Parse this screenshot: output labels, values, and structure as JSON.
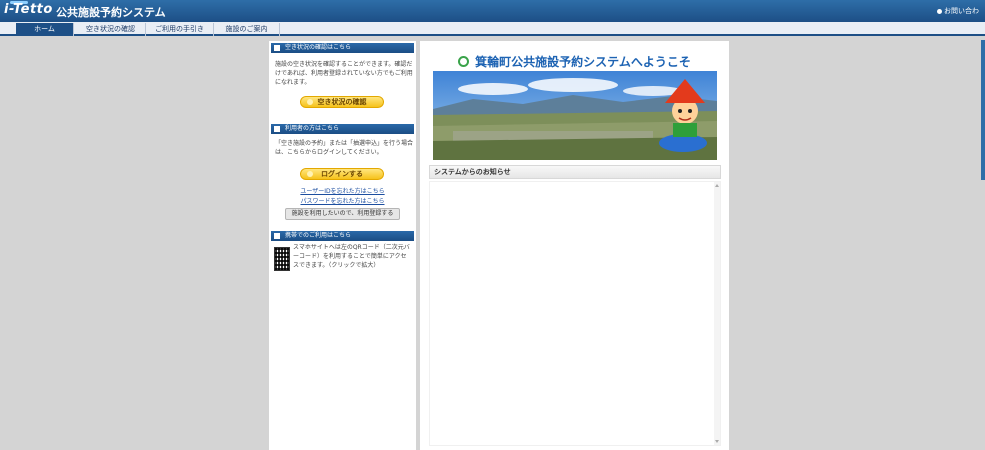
{
  "header": {
    "logo": "i-Tetto",
    "title": "公共施設予約システム",
    "contact": "お問い合わ"
  },
  "nav": {
    "tabs": [
      {
        "label": "ホーム",
        "active": true
      },
      {
        "label": "空き状況の確認",
        "active": false
      },
      {
        "label": "ご利用の手引き",
        "active": false
      },
      {
        "label": "施設のご案内",
        "active": false
      }
    ]
  },
  "sidebar": {
    "availability": {
      "heading": "空き状況の確認はこちら",
      "text": "施設の空き状況を確認することができます。確認だけであれば、利用者登録されていない方でもご利用になれます。",
      "button": "空き状況の確認"
    },
    "users": {
      "heading": "利用者の方はこちら",
      "text": "「空き施設の予約」または「抽選申込」を行う場合は、こちらからログインしてください。",
      "login_button": "ログインする",
      "forgot_id": "ユーザーIDを忘れた方はこちら",
      "forgot_password": "パスワードを忘れた方はこちら",
      "register_button": "施設を利用したいので、利用登録する"
    },
    "mobile": {
      "heading": "携帯でのご利用はこちら",
      "text": "スマホサイトへは左のQRコード（二次元バーコード）を利用することで簡単にアクセスできます。（クリックで拡大）"
    }
  },
  "main": {
    "welcome": "箕輪町公共施設予約システムへようこそ",
    "notice_heading": "システムからのお知らせ"
  },
  "colors": {
    "header_blue": "#1d4f86",
    "accent_yellow": "#f6c21b",
    "link_blue": "#1c4ea0",
    "welcome_blue": "#1d63b3",
    "ring_green": "#3aa34a"
  }
}
